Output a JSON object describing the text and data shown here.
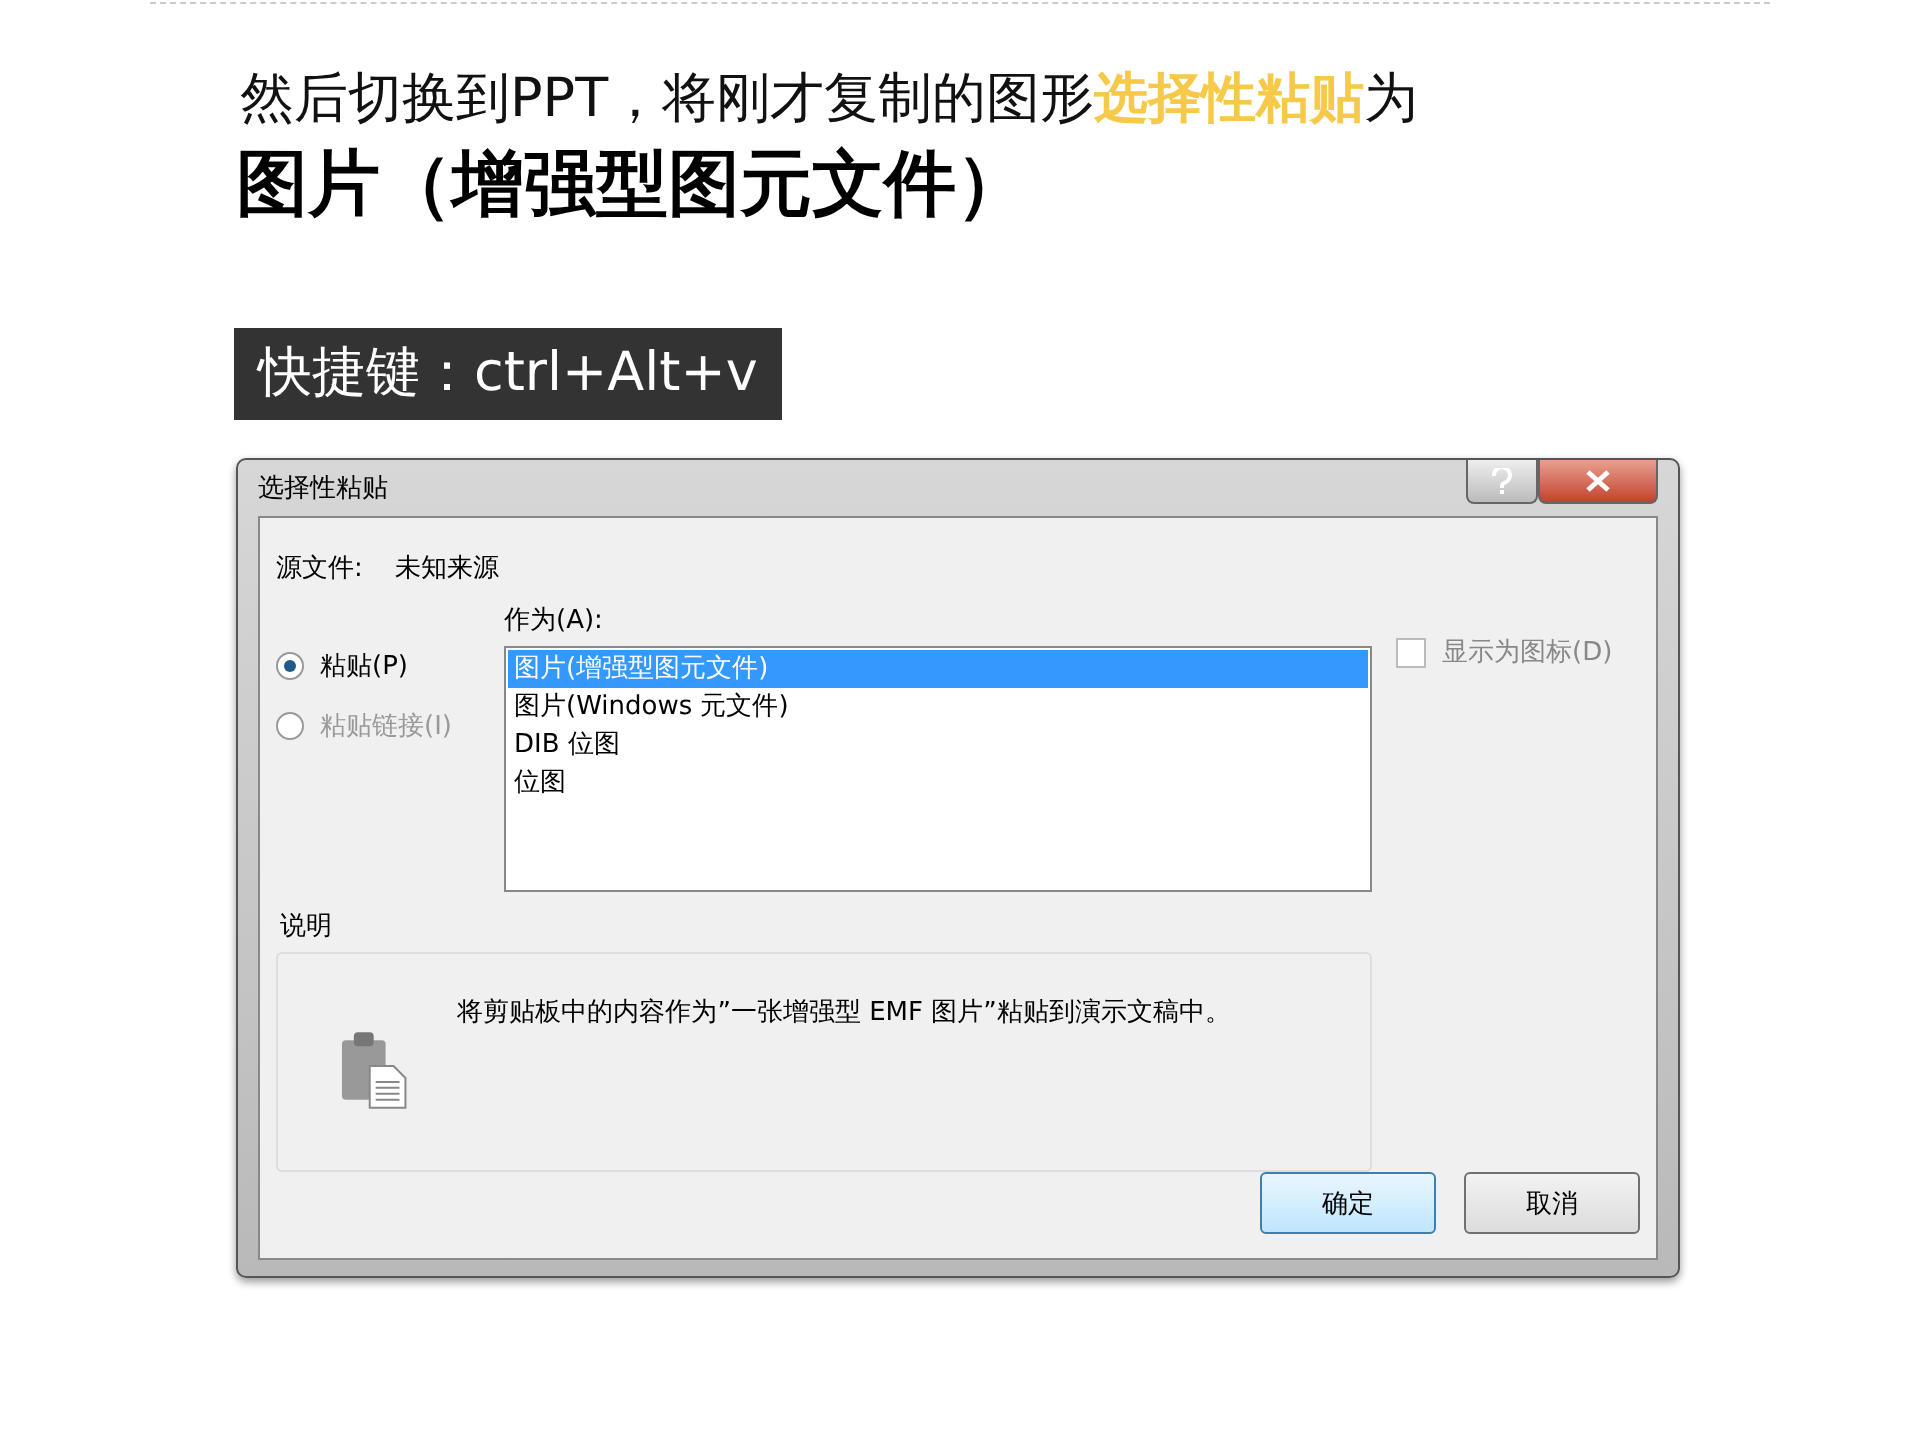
{
  "slide": {
    "heading": [
      {
        "kind": "plain",
        "text": "然后切换到PPT，将刚才复制的图形"
      },
      {
        "kind": "highlight",
        "text": "选择性粘贴"
      },
      {
        "kind": "plain",
        "text": "为"
      }
    ],
    "subheading": "图片（增强型图元文件）",
    "shortcut": "快捷键：ctrl+Alt+v"
  },
  "dialog": {
    "title": "选择性粘贴",
    "source_label": "源文件:",
    "source_value": "未知来源",
    "as_label": "作为(A):",
    "options": [
      {
        "label": "粘贴(P)",
        "selected": true,
        "disabled": false
      },
      {
        "label": "粘贴链接(I)",
        "selected": false,
        "disabled": true
      }
    ],
    "list": [
      {
        "label": "图片(增强型图元文件)",
        "selected": true
      },
      {
        "label": "图片(Windows 元文件)",
        "selected": false
      },
      {
        "label": "DIB 位图",
        "selected": false
      },
      {
        "label": "位图",
        "selected": false
      }
    ],
    "display_as_icon": {
      "label": "显示为图标(D)",
      "checked": false,
      "disabled": true
    },
    "description": {
      "title": "说明",
      "text": "将剪贴板中的内容作为”一张增强型 EMF 图片”粘贴到演示文稿中。"
    },
    "buttons": [
      {
        "label": "确定",
        "default": true
      },
      {
        "label": "取消",
        "default": false
      }
    ]
  }
}
